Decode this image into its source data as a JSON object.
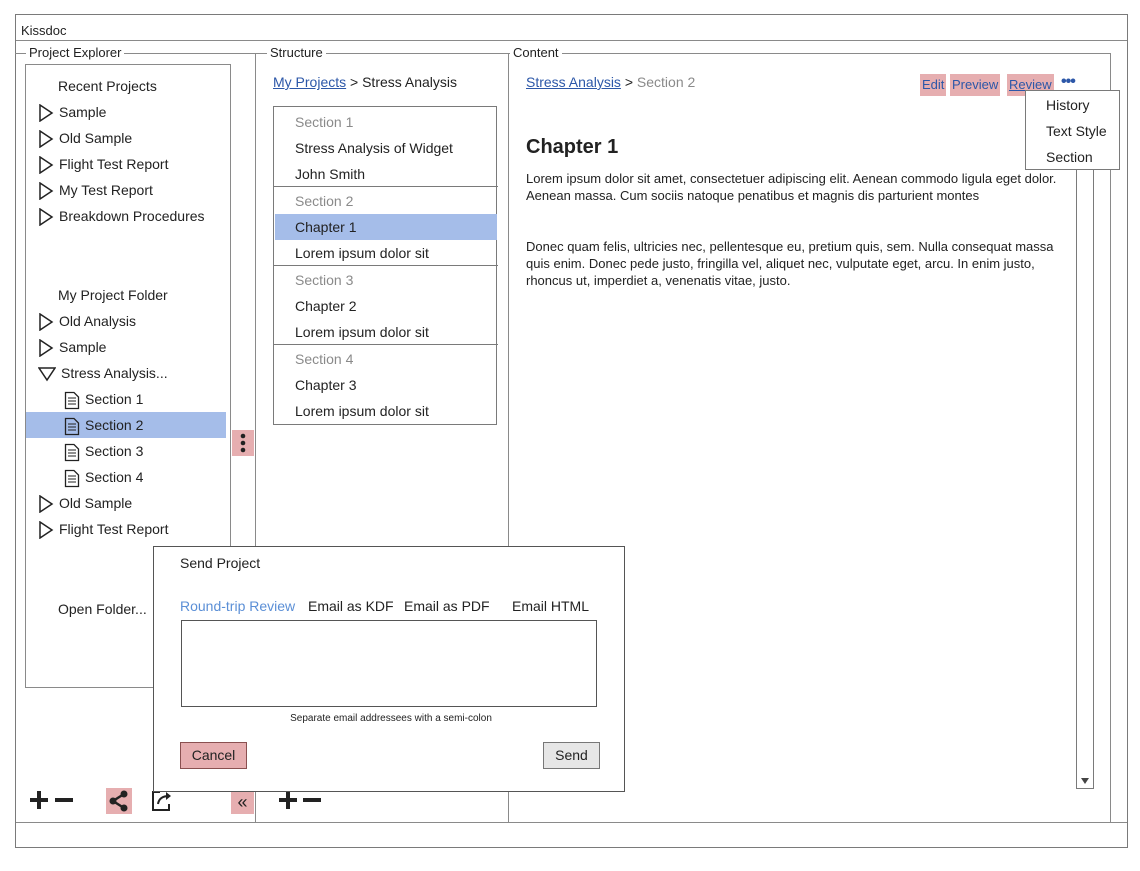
{
  "app": {
    "title": "Kissdoc"
  },
  "explorer": {
    "legend": "Project Explorer",
    "recent_heading": "Recent Projects",
    "recent": [
      "Sample",
      "Old Sample",
      "Flight Test Report",
      "My Test Report",
      "Breakdown Procedures"
    ],
    "folder_heading": "My Project Folder",
    "folder_items_top": [
      "Old Analysis",
      "Sample"
    ],
    "expanded_item": "Stress Analysis...",
    "sections": [
      "Section 1",
      "Section 2",
      "Section 3",
      "Section 4"
    ],
    "folder_items_bottom": [
      "Old Sample",
      "Flight Test Report"
    ],
    "open_folder": "Open Folder..."
  },
  "structure": {
    "legend": "Structure",
    "breadcrumb_link": "My Projects",
    "breadcrumb_sep": ">",
    "breadcrumb_current": "Stress Analysis",
    "groups": [
      {
        "header": "Section 1",
        "items": [
          "Stress Analysis of Widget",
          "John Smith"
        ]
      },
      {
        "header": "Section 2",
        "items": [
          "Chapter 1",
          "Lorem ipsum dolor sit"
        ]
      },
      {
        "header": "Section 3",
        "items": [
          "Chapter 2",
          "Lorem ipsum dolor sit"
        ]
      },
      {
        "header": "Section 4",
        "items": [
          "Chapter 3",
          "Lorem ipsum dolor sit"
        ]
      }
    ]
  },
  "content": {
    "legend": "Content",
    "breadcrumb_link": "Stress Analysis",
    "breadcrumb_sep": ">",
    "breadcrumb_current": "Section 2",
    "actions": {
      "edit": "Edit",
      "preview": "Preview",
      "review": "Review",
      "more": "•••"
    },
    "menu": [
      "History",
      "Text Style",
      "Section"
    ],
    "heading": "Chapter 1",
    "para1": "Lorem ipsum dolor sit amet, consectetuer adipiscing elit. Aenean commodo ligula eget dolor. Aenean massa. Cum sociis natoque penatibus et magnis dis parturient montes",
    "para2": "Donec quam felis, ultricies nec, pellentesque eu, pretium quis, sem. Nulla consequat massa quis enim. Donec pede justo, fringilla vel, aliquet nec, vulputate eget, arcu. In enim justo, rhoncus ut, imperdiet a, venenatis vitae, justo."
  },
  "dialog": {
    "title": "Send Project",
    "tabs": [
      "Round-trip Review",
      "Email as KDF",
      "Email as PDF",
      "Email HTML"
    ],
    "hint": "Separate email addressees with a semi-colon",
    "cancel": "Cancel",
    "send": "Send"
  },
  "colors": {
    "selection": "#a5bde9",
    "highlight": "#e6aeb0",
    "link": "#2c57a8",
    "active_tab": "#5b8fd6"
  }
}
